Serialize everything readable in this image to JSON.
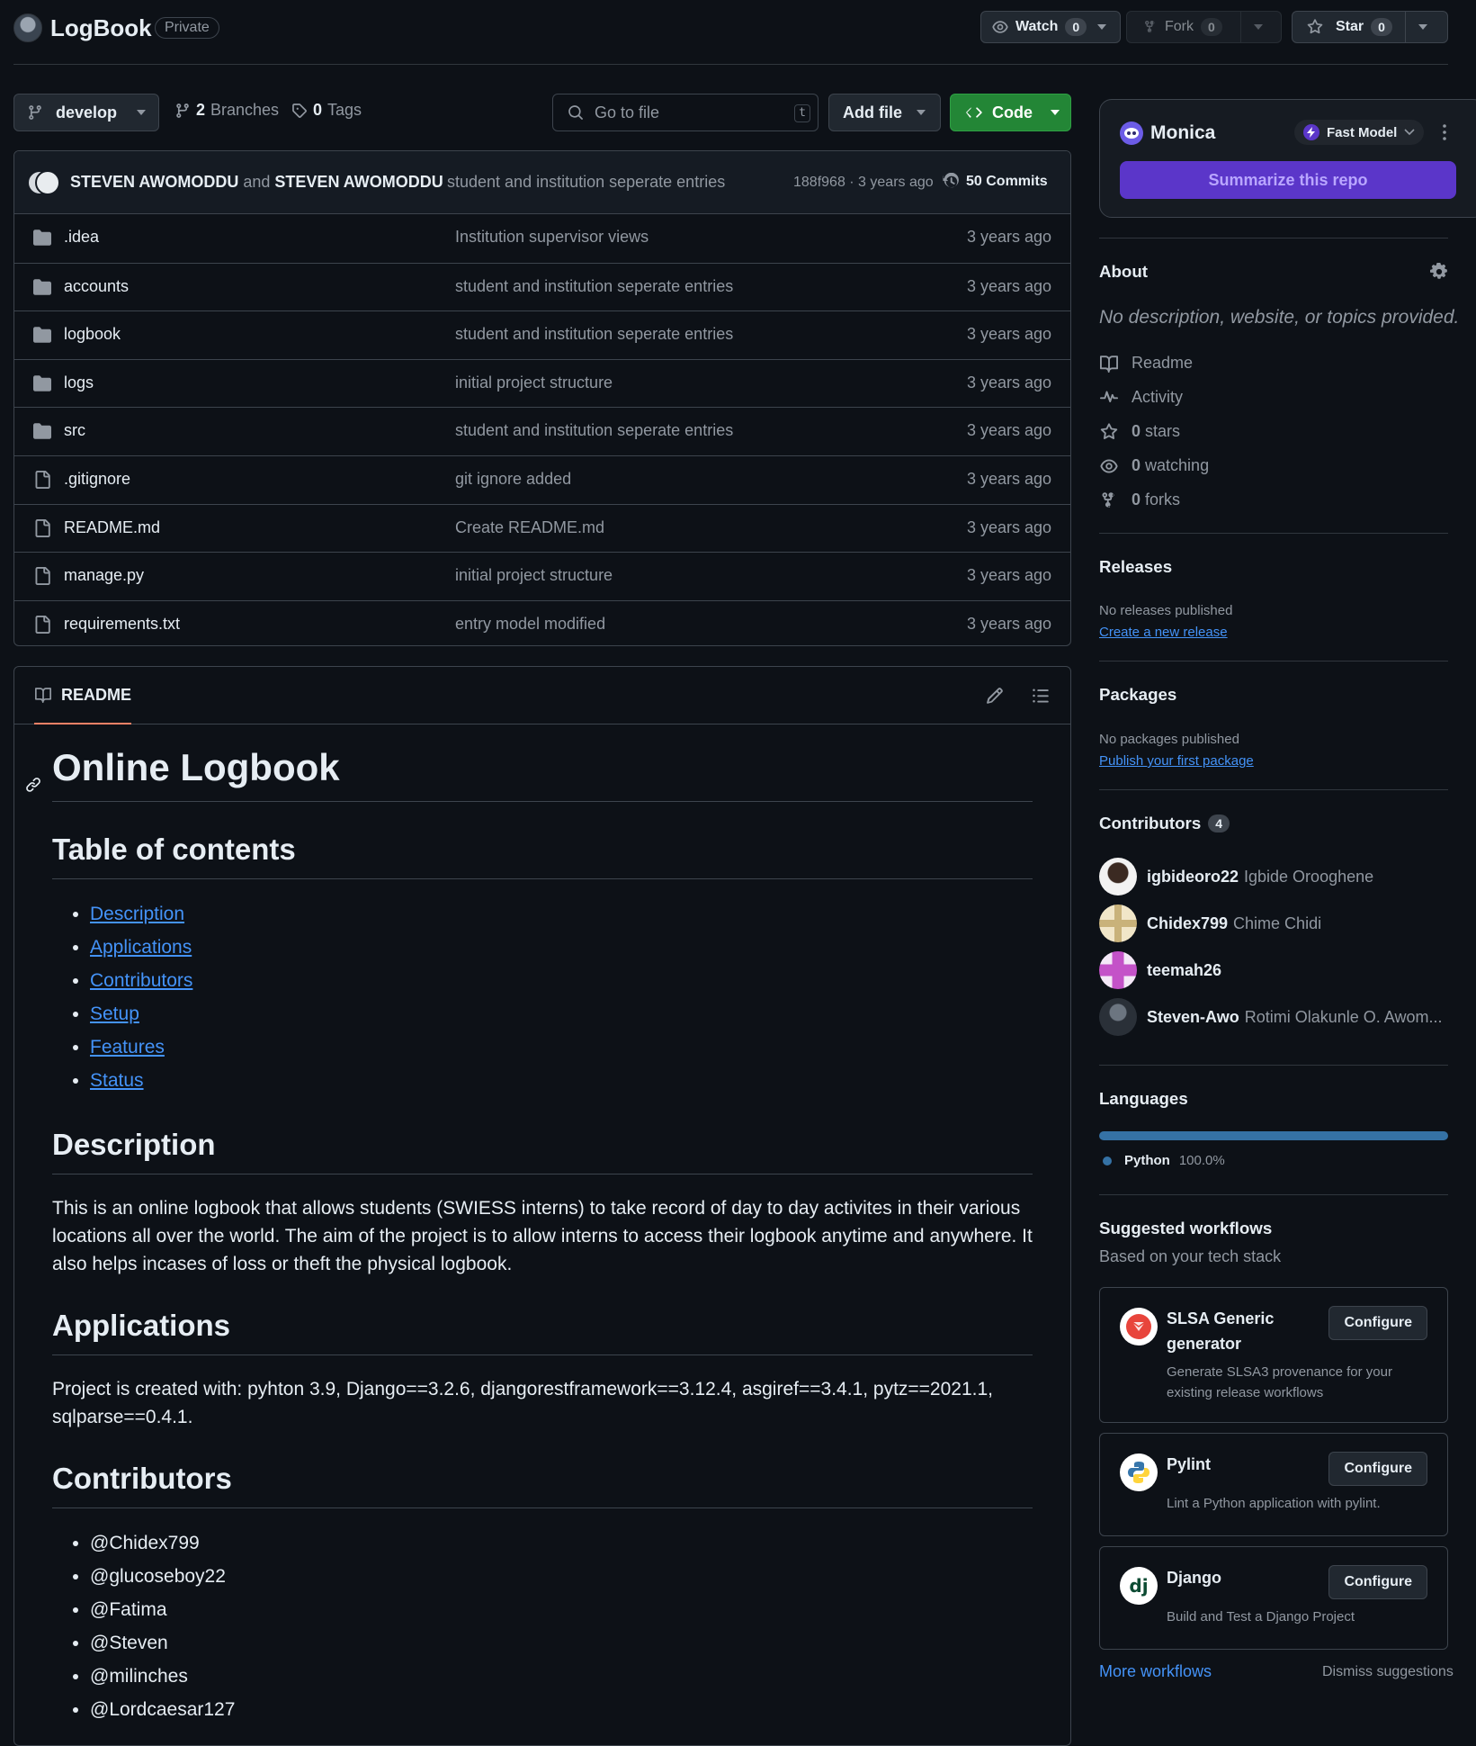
{
  "header": {
    "repo_name": "LogBook",
    "visibility": "Private",
    "watch_label": "Watch",
    "watch_count": "0",
    "fork_label": "Fork",
    "fork_count": "0",
    "star_label": "Star",
    "star_count": "0"
  },
  "toolbar": {
    "branch": "develop",
    "branches_count": "2",
    "branches_label": "Branches",
    "tags_count": "0",
    "tags_label": "Tags",
    "goto_placeholder": "Go to file",
    "goto_key": "t",
    "add_file_label": "Add file",
    "code_label": "Code"
  },
  "commit": {
    "author1": "STEVEN AWOMODDU",
    "and": "and",
    "author2": "STEVEN AWOMODDU",
    "message": "student and institution seperate entries",
    "hash_age": "188f968 · 3 years ago",
    "commits_label": "50 Commits"
  },
  "files": [
    {
      "type": "dir",
      "name": ".idea",
      "message": "Institution supervisor views",
      "age": "3 years ago"
    },
    {
      "type": "dir",
      "name": "accounts",
      "message": "student and institution seperate entries",
      "age": "3 years ago"
    },
    {
      "type": "dir",
      "name": "logbook",
      "message": "student and institution seperate entries",
      "age": "3 years ago"
    },
    {
      "type": "dir",
      "name": "logs",
      "message": "initial project structure",
      "age": "3 years ago"
    },
    {
      "type": "dir",
      "name": "src",
      "message": "student and institution seperate entries",
      "age": "3 years ago"
    },
    {
      "type": "file",
      "name": ".gitignore",
      "message": "git ignore added",
      "age": "3 years ago"
    },
    {
      "type": "file",
      "name": "README.md",
      "message": "Create README.md",
      "age": "3 years ago"
    },
    {
      "type": "file",
      "name": "manage.py",
      "message": "initial project structure",
      "age": "3 years ago"
    },
    {
      "type": "file",
      "name": "requirements.txt",
      "message": "entry model modified",
      "age": "3 years ago"
    }
  ],
  "readme": {
    "tab_label": "README",
    "title": "Online Logbook",
    "toc_heading": "Table of contents",
    "toc": [
      "Description",
      "Applications",
      "Contributors",
      "Setup",
      "Features",
      "Status"
    ],
    "description_heading": "Description",
    "description_text": "This is an online logbook that allows students (SWIESS interns) to take record of day to day activites in their various locations all over the world. The aim of the project is to allow interns to access their logbook anytime and anywhere. It also helps incases of loss or theft the physical logbook.",
    "applications_heading": "Applications",
    "applications_text": "Project is created with: pyhton 3.9, Django==3.2.6, djangorestframework==3.12.4, asgiref==3.4.1, pytz==2021.1, sqlparse==0.4.1.",
    "contributors_heading": "Contributors",
    "contributors": [
      "@Chidex799",
      "@glucoseboy22",
      "@Fatima",
      "@Steven",
      "@milinches",
      "@Lordcaesar127"
    ]
  },
  "monica": {
    "name": "Monica",
    "model_label": "Fast Model",
    "summarize_label": "Summarize this repo"
  },
  "about": {
    "heading": "About",
    "description": "No description, website, or topics provided.",
    "readme": "Readme",
    "activity": "Activity",
    "stars_count": "0",
    "stars_label": "stars",
    "watching_count": "0",
    "watching_label": "watching",
    "forks_count": "0",
    "forks_label": "forks"
  },
  "releases": {
    "heading": "Releases",
    "empty": "No releases published",
    "link": "Create a new release"
  },
  "packages": {
    "heading": "Packages",
    "empty": "No packages published",
    "link": "Publish your first package"
  },
  "contributors": {
    "heading": "Contributors",
    "count": "4",
    "list": [
      {
        "login": "igbideoro22",
        "name": "Igbide Orooghene"
      },
      {
        "login": "Chidex799",
        "name": "Chime Chidi"
      },
      {
        "login": "teemah26",
        "name": ""
      },
      {
        "login": "Steven-Awo",
        "name": "Rotimi Olakunle O. Awom..."
      }
    ]
  },
  "languages": {
    "heading": "Languages",
    "items": [
      {
        "name": "Python",
        "percent": "100.0%",
        "share": 1.0,
        "color": "#3572A5"
      }
    ]
  },
  "workflows": {
    "heading": "Suggested workflows",
    "subheading": "Based on your tech stack",
    "items": [
      {
        "name": "SLSA Generic generator",
        "description": "Generate SLSA3 provenance for your existing release workflows",
        "button": "Configure"
      },
      {
        "name": "Pylint",
        "description": "Lint a Python application with pylint.",
        "button": "Configure"
      },
      {
        "name": "Django",
        "description": "Build and Test a Django Project",
        "button": "Configure"
      }
    ],
    "more_link": "More workflows",
    "dismiss_link": "Dismiss suggestions"
  },
  "colors": {
    "background": "#0d1117",
    "border": "#3d444d",
    "muted_text": "#9198a1",
    "link": "#4493f8",
    "code_button": "#238636",
    "monica_button": "#5b36c9",
    "tab_underline": "#f78166"
  }
}
